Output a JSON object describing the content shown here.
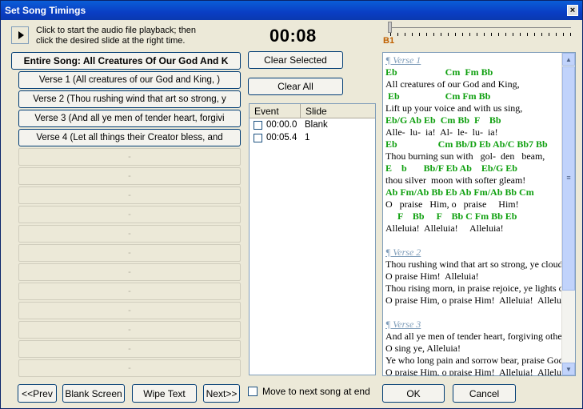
{
  "window": {
    "title": "Set Song Timings",
    "close_glyph": "×"
  },
  "instructions": {
    "line1": "Click to start the audio file playback; then",
    "line2": "click the desired slide at the right time."
  },
  "timer": "00:08",
  "slider": {
    "marker": "B1"
  },
  "slides": {
    "entire_song": "Entire Song: All Creatures Of Our God And K",
    "verses": [
      "Verse 1 (All creatures of our God and King, )",
      "Verse 2 (Thou rushing wind that art so strong, y",
      "Verse 3 (And all ye men of tender heart, forgivi",
      "Verse 4 (Let all things their Creator bless, and"
    ],
    "empty_slots": [
      "-",
      "-",
      "-",
      "-",
      "-",
      "-",
      "-",
      "-",
      "-",
      "-",
      "-",
      "-"
    ]
  },
  "controls": {
    "clear_selected": "Clear Selected",
    "clear_all": "Clear All"
  },
  "events": {
    "headers": {
      "event": "Event",
      "slide": "Slide"
    },
    "rows": [
      {
        "time": "00:00.0",
        "slide": "Blank"
      },
      {
        "time": "00:05.4",
        "slide": "1"
      }
    ]
  },
  "move_next_label": "Move to next song at end",
  "nav": {
    "prev": "<<Prev",
    "blank": "Blank Screen",
    "wipe": "Wipe Text",
    "next": "Next>>"
  },
  "dialog": {
    "ok": "OK",
    "cancel": "Cancel"
  },
  "preview": [
    {
      "type": "heading",
      "text": "¶ Verse 1"
    },
    {
      "type": "chord",
      "text": "Eb                    Cm  Fm Bb"
    },
    {
      "type": "lyric",
      "text": "All creatures of our God and King,"
    },
    {
      "type": "chord",
      "text": " Eb                   Cm Fm Bb"
    },
    {
      "type": "lyric",
      "text": "Lift up your voice and with us sing,"
    },
    {
      "type": "chord",
      "text": "Eb/G Ab Eb  Cm Bb  F    Bb"
    },
    {
      "type": "lyric",
      "text": "Alle-  lu-  ia!  Al-  le-  lu-  ia!"
    },
    {
      "type": "chord",
      "text": "Eb                 Cm Bb/D Eb Ab/C Bb7 Bb"
    },
    {
      "type": "lyric",
      "text": "Thou burning sun with   gol-  den   beam,"
    },
    {
      "type": "chord",
      "text": "E    b       Bb/F Eb Ab    Eb/G Eb"
    },
    {
      "type": "lyric",
      "text": "thou silver  moon with softer gleam!"
    },
    {
      "type": "chord",
      "text": "Ab Fm/Ab Bb Eb Ab Fm/Ab Bb Cm"
    },
    {
      "type": "lyric",
      "text": "O   praise   Him, o   praise     Him!"
    },
    {
      "type": "chord",
      "text": "     F    Bb     F    Bb C Fm Bb Eb"
    },
    {
      "type": "lyric",
      "text": "Alleluia!  Alleluia!     Alleluia!"
    },
    {
      "type": "blank",
      "text": ""
    },
    {
      "type": "heading",
      "text": "¶ Verse 2"
    },
    {
      "type": "lyric",
      "text": "Thou rushing wind that art so strong, ye clouds"
    },
    {
      "type": "lyric",
      "text": "O praise Him!  Alleluia!"
    },
    {
      "type": "lyric",
      "text": "Thou rising morn, in praise rejoice, ye lights of"
    },
    {
      "type": "lyric",
      "text": "O praise Him, o praise Him!  Alleluia!  Alleluia!"
    },
    {
      "type": "blank",
      "text": ""
    },
    {
      "type": "heading",
      "text": "¶ Verse 3"
    },
    {
      "type": "lyric",
      "text": "And all ye men of tender heart, forgiving others"
    },
    {
      "type": "lyric",
      "text": "O sing ye, Alleluia!"
    },
    {
      "type": "lyric",
      "text": "Ye who long pain and sorrow bear, praise God"
    },
    {
      "type": "lyric",
      "text": "O praise Him, o praise Him!  Alleluia!  Alleluia!"
    }
  ],
  "scrollbar": {
    "up_glyph": "▲",
    "down_glyph": "▼",
    "grip_glyph": "≡"
  }
}
